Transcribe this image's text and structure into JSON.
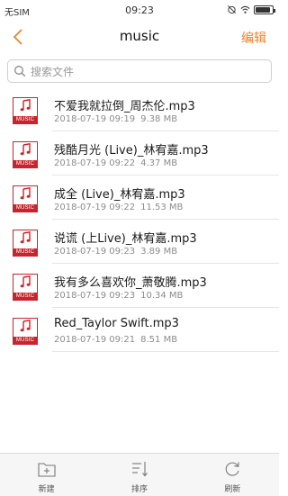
{
  "statusbar": {
    "carrier": "无SIM",
    "time": "09:23",
    "battery_level": 0.9
  },
  "navbar": {
    "title": "music",
    "edit_label": "编辑",
    "accent_color": "#f0822a"
  },
  "search": {
    "placeholder": "搜索文件"
  },
  "files": [
    {
      "name": "不爱我就拉倒_周杰伦.mp3",
      "date": "2018-07-19 09:19",
      "size": "9.38 MB",
      "icon": "music-file-icon",
      "icon_tag": "MUSIC"
    },
    {
      "name": "残酷月光 (Live)_林宥嘉.mp3",
      "date": "2018-07-19 09:22",
      "size": "4.37 MB",
      "icon": "music-file-icon",
      "icon_tag": "MUSIC"
    },
    {
      "name": "成全 (Live)_林宥嘉.mp3",
      "date": "2018-07-19 09:22",
      "size": "11.53 MB",
      "icon": "music-file-icon",
      "icon_tag": "MUSIC"
    },
    {
      "name": "说谎 (上Live)_林宥嘉.mp3",
      "date": "2018-07-19 09:23",
      "size": "3.89 MB",
      "icon": "music-file-icon",
      "icon_tag": "MUSIC"
    },
    {
      "name": "我有多么喜欢你_萧敬腾.mp3",
      "date": "2018-07-19 09:23",
      "size": "10.34 MB",
      "icon": "music-file-icon",
      "icon_tag": "MUSIC"
    },
    {
      "name": "Red_Taylor Swift.mp3",
      "date": "2018-07-19 09:21",
      "size": "8.51 MB",
      "icon": "music-file-icon",
      "icon_tag": "MUSIC"
    }
  ],
  "toolbar": {
    "new_label": "新建",
    "sort_label": "排序",
    "refresh_label": "刷新"
  }
}
